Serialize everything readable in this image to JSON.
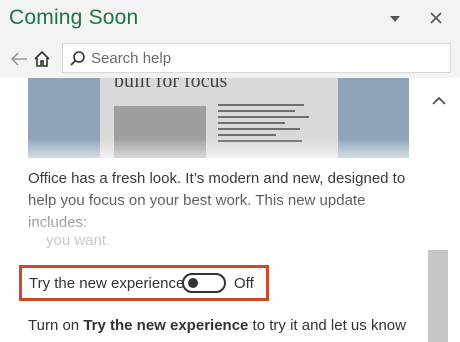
{
  "window": {
    "title": "Coming Soon",
    "accent_color": "#217346"
  },
  "nav": {
    "back_icon": "back-arrow-icon",
    "home_icon": "home-icon",
    "search_placeholder": "Search help"
  },
  "preview": {
    "heading": "built for focus"
  },
  "content": {
    "intro": "Office has a fresh look. It’s modern and new, designed to help you focus on your best work. This new update includes:",
    "faded_text": "you want.",
    "toggle_label": "Try the new experience",
    "toggle_state": "Off",
    "toggle_on": false,
    "turn_on_prefix": "Turn on ",
    "turn_on_bold": "Try the new experience",
    "turn_on_suffix": " to try it and let us know"
  },
  "colors": {
    "highlight_border": "#d24726"
  }
}
